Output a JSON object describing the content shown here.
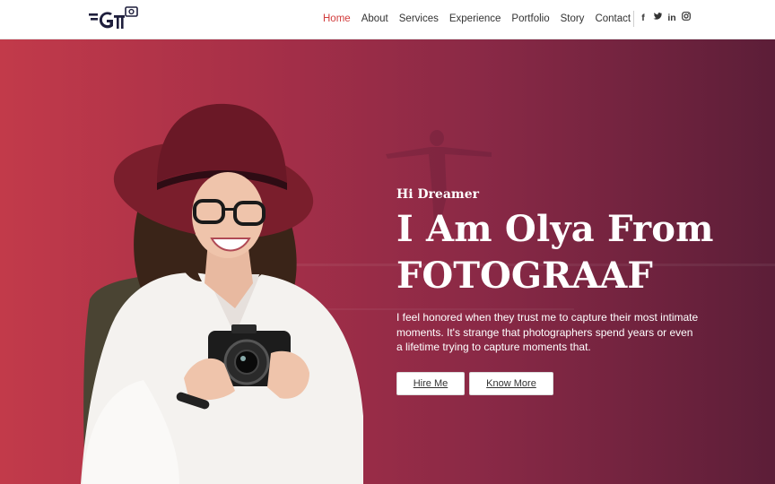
{
  "brand": {
    "logo_text": "G"
  },
  "nav": {
    "items": [
      {
        "label": "Home",
        "active": true
      },
      {
        "label": "About"
      },
      {
        "label": "Services"
      },
      {
        "label": "Experience"
      },
      {
        "label": "Portfolio"
      },
      {
        "label": "Story"
      },
      {
        "label": "Contact"
      }
    ]
  },
  "social": {
    "icons": [
      "facebook-icon",
      "twitter-icon",
      "linkedin-icon",
      "instagram-icon"
    ],
    "glyphs": [
      "f",
      "t",
      "in",
      "◎"
    ]
  },
  "hero": {
    "greeting": "Hi Dreamer",
    "title_line1": "I Am Olya From",
    "title_line2": "FOTOGRAAF",
    "description": "I feel honored when they trust me to capture their most intimate moments. It's strange that photographers spend years or even a lifetime trying to capture moments that.",
    "buttons": {
      "hire": "Hire Me",
      "know_more": "Know More"
    }
  },
  "colors": {
    "accent": "#d23c3c",
    "hero_gradient_start": "#c23a4a",
    "hero_gradient_end": "#5c1e38",
    "text": "#333333"
  }
}
